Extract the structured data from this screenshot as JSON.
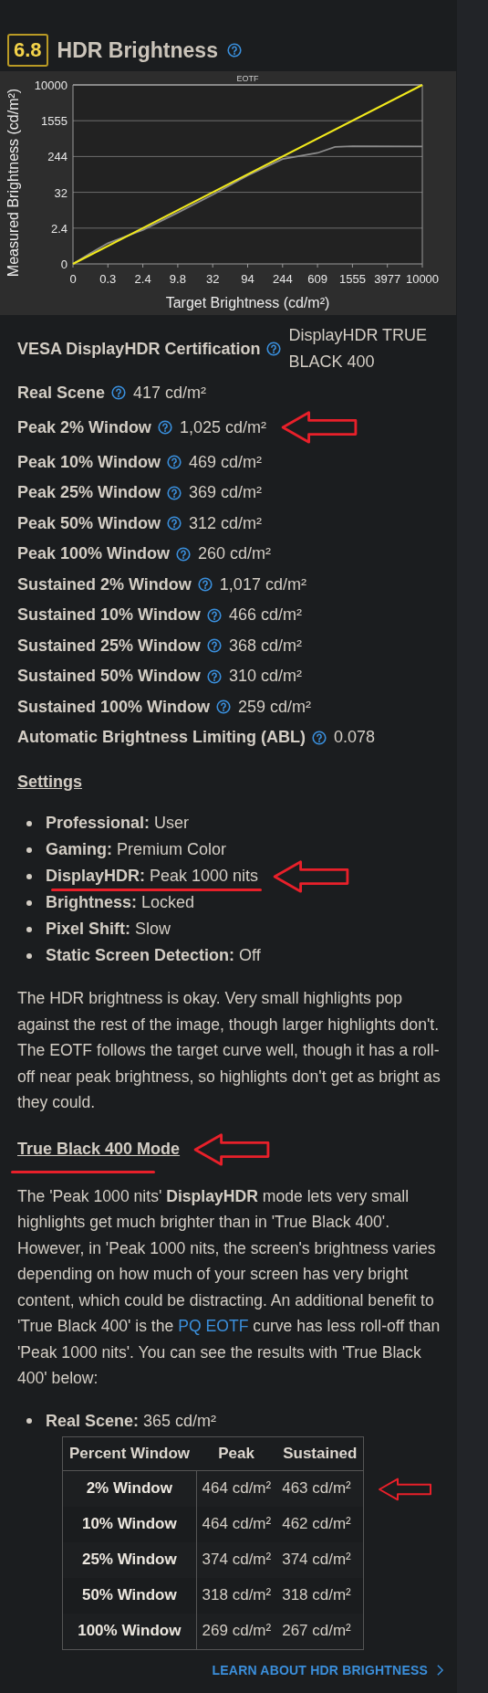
{
  "header": {
    "score": "6.8",
    "title": "HDR Brightness"
  },
  "chart": {
    "title": "EOTF",
    "xlabel": "Target Brightness (cd/m²)",
    "ylabel": "Measured Brightness (cd/m²)",
    "x_tick_labels": [
      "0",
      "0.3",
      "2.4",
      "9.8",
      "32",
      "94",
      "244",
      "609",
      "1555",
      "3977",
      "10000"
    ],
    "y_tick_labels": [
      "10000",
      "1555",
      "244",
      "32",
      "2.4",
      "0"
    ]
  },
  "facts": [
    {
      "label": "VESA DisplayHDR Certification",
      "value": "DisplayHDR TRUE BLACK 400",
      "red_arrow": false
    },
    {
      "label": "Real Scene",
      "value": "417 cd/m²",
      "red_arrow": false
    },
    {
      "label": "Peak 2% Window",
      "value": "1,025 cd/m²",
      "red_arrow": true
    },
    {
      "label": "Peak 10% Window",
      "value": "469 cd/m²",
      "red_arrow": false
    },
    {
      "label": "Peak 25% Window",
      "value": "369 cd/m²",
      "red_arrow": false
    },
    {
      "label": "Peak 50% Window",
      "value": "312 cd/m²",
      "red_arrow": false
    },
    {
      "label": "Peak 100% Window",
      "value": "260 cd/m²",
      "red_arrow": false
    },
    {
      "label": "Sustained 2% Window",
      "value": "1,017 cd/m²",
      "red_arrow": false
    },
    {
      "label": "Sustained 10% Window",
      "value": "466 cd/m²",
      "red_arrow": false
    },
    {
      "label": "Sustained 25% Window",
      "value": "368 cd/m²",
      "red_arrow": false
    },
    {
      "label": "Sustained 50% Window",
      "value": "310 cd/m²",
      "red_arrow": false
    },
    {
      "label": "Sustained 100% Window",
      "value": "259 cd/m²",
      "red_arrow": false
    },
    {
      "label": "Automatic Brightness Limiting (ABL)",
      "value": "0.078",
      "red_arrow": false
    }
  ],
  "settings": {
    "heading": "Settings",
    "items": [
      {
        "label": "Professional:",
        "value": "User",
        "red_underline": false,
        "red_arrow": false
      },
      {
        "label": "Gaming:",
        "value": "Premium Color",
        "red_underline": false,
        "red_arrow": false
      },
      {
        "label": "DisplayHDR:",
        "value": "Peak 1000 nits",
        "red_underline": true,
        "red_arrow": true
      },
      {
        "label": "Brightness:",
        "value": "Locked",
        "red_underline": false,
        "red_arrow": false
      },
      {
        "label": "Pixel Shift:",
        "value": "Slow",
        "red_underline": false,
        "red_arrow": false
      },
      {
        "label": "Static Screen Detection:",
        "value": "Off",
        "red_underline": false,
        "red_arrow": false
      }
    ]
  },
  "summary": "The HDR brightness is okay. Very small highlights pop against the rest of the image, though larger highlights don't. The EOTF follows the target curve well, though it has a roll-off near peak brightness, so highlights don't get as bright as they could.",
  "mode": {
    "heading": "True Black 400 Mode",
    "red_underline": true,
    "red_arrow": true,
    "text_before": "The 'Peak 1000 nits' **DisplayHDR** mode lets very small highlights get much brighter than in 'True Black 400'. However, in 'Peak 1000 nits, the screen's brightness varies depending on how much of your screen has very bright content, which could be distracting. An additional benefit to 'True Black 400' is the",
    "link": "PQ EOTF",
    "text_after": "curve has less roll-off than 'Peak 1000 nits'. You can see the results with 'True Black 400' below:",
    "bullet": {
      "label": "Real Scene:",
      "value": "365 cd/m²"
    },
    "table": {
      "columns": [
        "Percent Window",
        "Peak",
        "Sustained"
      ],
      "rows": [
        {
          "cells": [
            "2% Window",
            "464 cd/m²",
            "463 cd/m²"
          ],
          "red_arrow": true
        },
        {
          "cells": [
            "10% Window",
            "464 cd/m²",
            "462 cd/m²"
          ],
          "red_arrow": false
        },
        {
          "cells": [
            "25% Window",
            "374 cd/m²",
            "374 cd/m²"
          ],
          "red_arrow": false
        },
        {
          "cells": [
            "50% Window",
            "318 cd/m²",
            "318 cd/m²"
          ],
          "red_arrow": false
        },
        {
          "cells": [
            "100% Window",
            "269 cd/m²",
            "267 cd/m²"
          ],
          "red_arrow": false
        }
      ]
    }
  },
  "learn_link": "LEARN ABOUT HDR BRIGHTNESS"
}
